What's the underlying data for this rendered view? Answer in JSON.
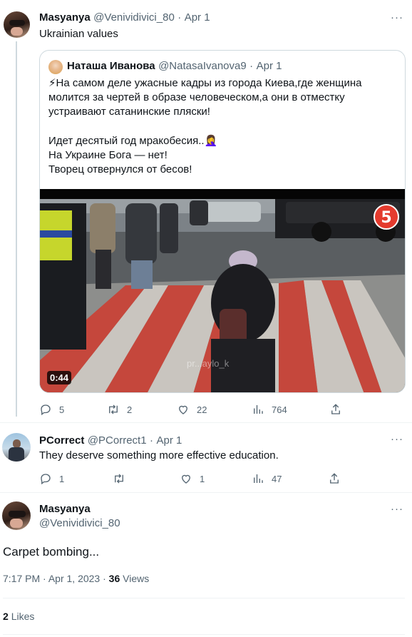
{
  "tweet1": {
    "name": "Masyanya",
    "handle": "@Venividivici_80",
    "sep": "·",
    "date": "Apr 1",
    "text": "Ukrainian values",
    "more": "···"
  },
  "quote": {
    "name": "Наташа Иванова",
    "handle": "@NatasaIvanova9",
    "sep": "·",
    "date": "Apr 1",
    "lines": [
      "⚡На самом деле ужасные кадры из города Киева,где женщина",
      "молится за чертей в образе человеческом,а они в отместку",
      "устраивают сатанинские пляски!",
      "",
      "Идет десятый год мракобесия..🤦‍♀️",
      "На Украине Бога — нет!",
      "Творец отвернулся от бесов!"
    ],
    "video_duration": "0:44",
    "watermark": "pr...aylo_k"
  },
  "tweet1_actions": {
    "replies": "5",
    "retweets": "2",
    "likes": "22",
    "views": "764"
  },
  "tweet2": {
    "name": "PCorrect",
    "handle": "@PCorrect1",
    "sep": "·",
    "date": "Apr 1",
    "text": "They deserve something more effective education.",
    "more": "···"
  },
  "tweet2_actions": {
    "replies": "1",
    "retweets": "",
    "likes": "1",
    "views": "47"
  },
  "main": {
    "name": "Masyanya",
    "handle": "@Venividivici_80",
    "text": "Carpet bombing...",
    "time": "7:17 PM",
    "sep": "·",
    "date": "Apr 1, 2023",
    "sep2": "·",
    "views_count": "36",
    "views_label": "Views",
    "more": "···"
  },
  "likes": {
    "count": "2",
    "label": "Likes"
  }
}
